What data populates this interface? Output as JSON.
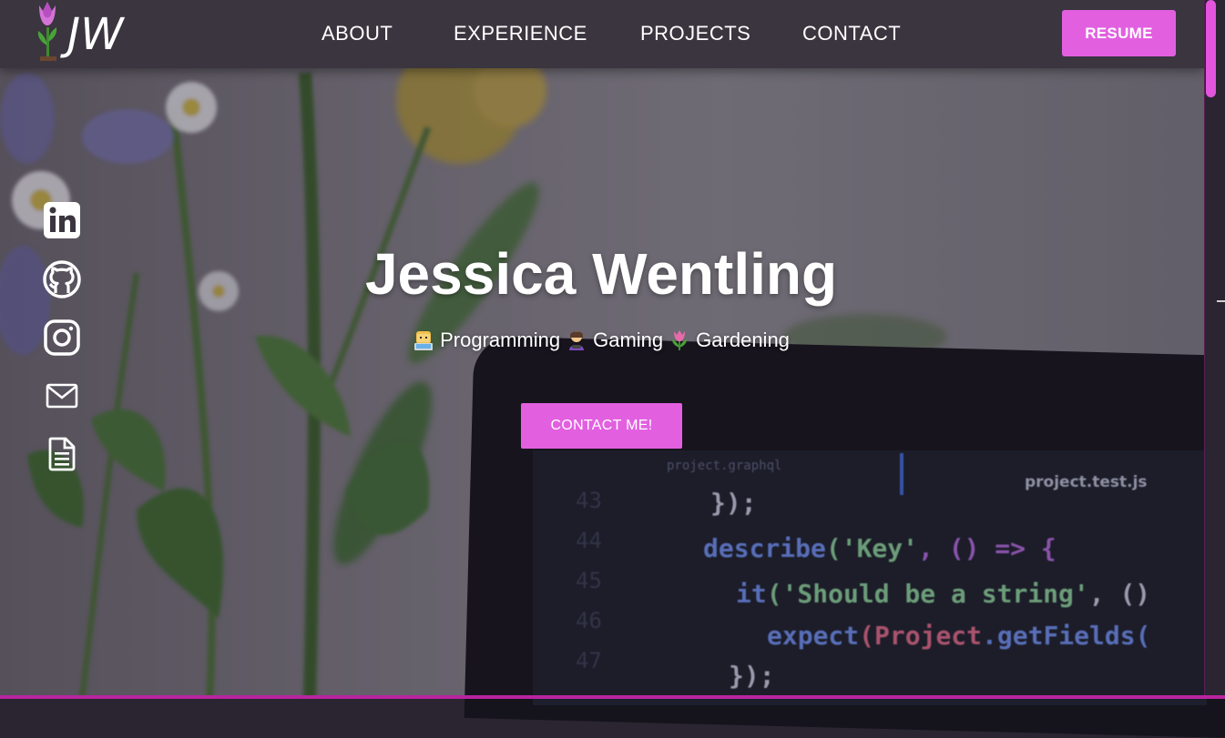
{
  "nav": {
    "logo_text": "JW",
    "links": [
      "ABOUT",
      "EXPERIENCE",
      "PROJECTS",
      "CONTACT"
    ],
    "resume_label": "RESUME"
  },
  "social": [
    "linkedin-icon",
    "github-icon",
    "instagram-icon",
    "mail-icon",
    "document-icon"
  ],
  "hero": {
    "name": "Jessica Wentling",
    "tagline": [
      {
        "emoji": "technologist-emoji",
        "label": "Programming"
      },
      {
        "emoji": "gamer-emoji",
        "label": "Gaming"
      },
      {
        "emoji": "tulip-emoji",
        "label": "Gardening"
      }
    ],
    "cta_label": "CONTACT ME!"
  },
  "code_preview": {
    "tab_left": "project.graphql",
    "tab_right": "project.test.js",
    "line_numbers": [
      "43",
      "44",
      "45",
      "46",
      "47"
    ],
    "line1": "});",
    "line2_fn": "describe",
    "line2_str": "('Key'",
    "line2_rest": ", () => {",
    "line3_fn": "it",
    "line3_str": "('Should be a string'",
    "line3_rest": ", ()",
    "line4_fn": "expect",
    "line4_obj": "(Project",
    "line4_rest": ".getFields(",
    "line5": "});"
  },
  "colors": {
    "accent": "#e260e0",
    "navbar": "#3b3540"
  }
}
